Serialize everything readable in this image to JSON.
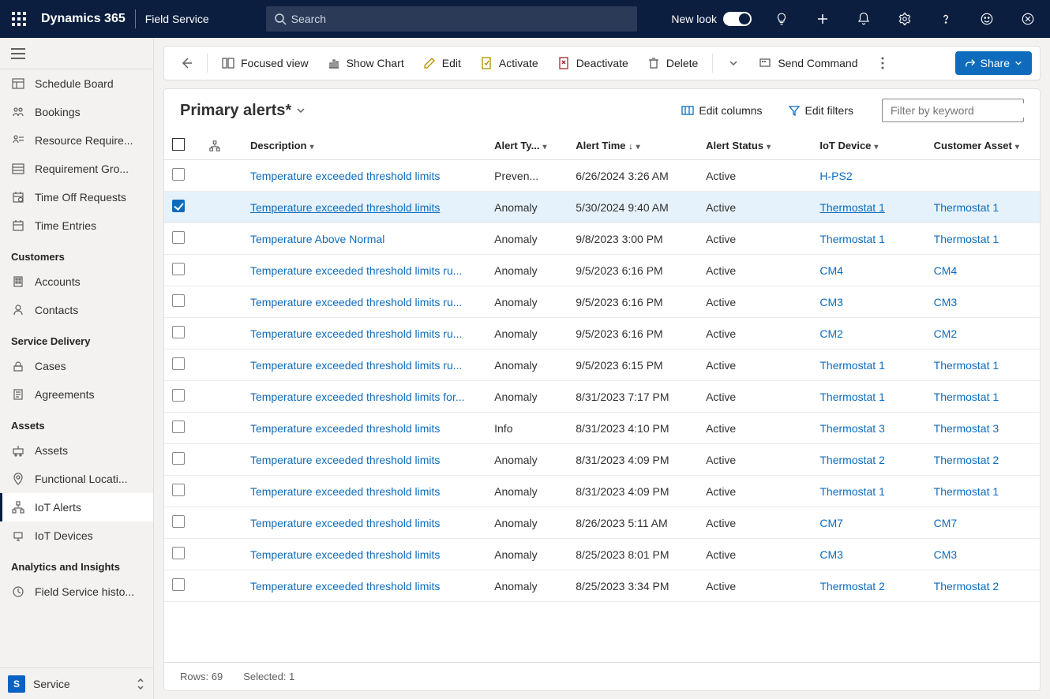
{
  "header": {
    "brand": "Dynamics 365",
    "module": "Field Service",
    "search_placeholder": "Search",
    "new_look_label": "New look"
  },
  "sidebar": {
    "groups": [
      {
        "items": [
          {
            "label": "Schedule Board",
            "icon": "board"
          },
          {
            "label": "Bookings",
            "icon": "bookings"
          },
          {
            "label": "Resource Require...",
            "icon": "resreq"
          },
          {
            "label": "Requirement Gro...",
            "icon": "reqgrp"
          },
          {
            "label": "Time Off Requests",
            "icon": "timeoff"
          },
          {
            "label": "Time Entries",
            "icon": "timeent"
          }
        ]
      },
      {
        "title": "Customers",
        "items": [
          {
            "label": "Accounts",
            "icon": "accounts"
          },
          {
            "label": "Contacts",
            "icon": "contacts"
          }
        ]
      },
      {
        "title": "Service Delivery",
        "items": [
          {
            "label": "Cases",
            "icon": "cases"
          },
          {
            "label": "Agreements",
            "icon": "agree"
          }
        ]
      },
      {
        "title": "Assets",
        "items": [
          {
            "label": "Assets",
            "icon": "assets"
          },
          {
            "label": "Functional Locati...",
            "icon": "funcloc"
          },
          {
            "label": "IoT Alerts",
            "icon": "iotalerts",
            "active": true
          },
          {
            "label": "IoT Devices",
            "icon": "iotdev"
          }
        ]
      },
      {
        "title": "Analytics and Insights",
        "items": [
          {
            "label": "Field Service histo...",
            "icon": "fshist"
          }
        ]
      }
    ],
    "app_switch": {
      "badge": "S",
      "label": "Service"
    }
  },
  "commands": {
    "focused": "Focused view",
    "chart": "Show Chart",
    "edit": "Edit",
    "activate": "Activate",
    "deactivate": "Deactivate",
    "delete": "Delete",
    "send": "Send Command",
    "share": "Share"
  },
  "view": {
    "title": "Primary alerts*",
    "edit_cols": "Edit columns",
    "edit_filters": "Edit filters",
    "filter_placeholder": "Filter by keyword"
  },
  "columns": [
    "Description",
    "Alert Ty...",
    "Alert Time",
    "Alert Status",
    "IoT Device",
    "Customer Asset"
  ],
  "rows": [
    {
      "sel": false,
      "desc": "Temperature exceeded threshold limits",
      "type": "Preven...",
      "time": "6/26/2024 3:26 AM",
      "status": "Active",
      "device": "H-PS2",
      "asset": ""
    },
    {
      "sel": true,
      "desc": "Temperature exceeded threshold limits",
      "type": "Anomaly",
      "time": "5/30/2024 9:40 AM",
      "status": "Active",
      "device": "Thermostat 1",
      "asset": "Thermostat 1"
    },
    {
      "sel": false,
      "desc": "Temperature Above Normal",
      "type": "Anomaly",
      "time": "9/8/2023 3:00 PM",
      "status": "Active",
      "device": "Thermostat 1",
      "asset": "Thermostat 1"
    },
    {
      "sel": false,
      "desc": "Temperature exceeded threshold limits ru...",
      "type": "Anomaly",
      "time": "9/5/2023 6:16 PM",
      "status": "Active",
      "device": "CM4",
      "asset": "CM4"
    },
    {
      "sel": false,
      "desc": "Temperature exceeded threshold limits ru...",
      "type": "Anomaly",
      "time": "9/5/2023 6:16 PM",
      "status": "Active",
      "device": "CM3",
      "asset": "CM3"
    },
    {
      "sel": false,
      "desc": "Temperature exceeded threshold limits ru...",
      "type": "Anomaly",
      "time": "9/5/2023 6:16 PM",
      "status": "Active",
      "device": "CM2",
      "asset": "CM2"
    },
    {
      "sel": false,
      "desc": "Temperature exceeded threshold limits ru...",
      "type": "Anomaly",
      "time": "9/5/2023 6:15 PM",
      "status": "Active",
      "device": "Thermostat 1",
      "asset": "Thermostat 1"
    },
    {
      "sel": false,
      "desc": "Temperature exceeded threshold limits for...",
      "type": "Anomaly",
      "time": "8/31/2023 7:17 PM",
      "status": "Active",
      "device": "Thermostat 1",
      "asset": "Thermostat 1"
    },
    {
      "sel": false,
      "desc": "Temperature exceeded threshold limits",
      "type": "Info",
      "time": "8/31/2023 4:10 PM",
      "status": "Active",
      "device": "Thermostat 3",
      "asset": "Thermostat 3"
    },
    {
      "sel": false,
      "desc": "Temperature exceeded threshold limits",
      "type": "Anomaly",
      "time": "8/31/2023 4:09 PM",
      "status": "Active",
      "device": "Thermostat 2",
      "asset": "Thermostat 2"
    },
    {
      "sel": false,
      "desc": "Temperature exceeded threshold limits",
      "type": "Anomaly",
      "time": "8/31/2023 4:09 PM",
      "status": "Active",
      "device": "Thermostat 1",
      "asset": "Thermostat 1"
    },
    {
      "sel": false,
      "desc": "Temperature exceeded threshold limits",
      "type": "Anomaly",
      "time": "8/26/2023 5:11 AM",
      "status": "Active",
      "device": "CM7",
      "asset": "CM7"
    },
    {
      "sel": false,
      "desc": "Temperature exceeded threshold limits",
      "type": "Anomaly",
      "time": "8/25/2023 8:01 PM",
      "status": "Active",
      "device": "CM3",
      "asset": "CM3"
    },
    {
      "sel": false,
      "desc": "Temperature exceeded threshold limits",
      "type": "Anomaly",
      "time": "8/25/2023 3:34 PM",
      "status": "Active",
      "device": "Thermostat 2",
      "asset": "Thermostat 2"
    }
  ],
  "footer": {
    "rows": "Rows: 69",
    "selected": "Selected: 1"
  }
}
